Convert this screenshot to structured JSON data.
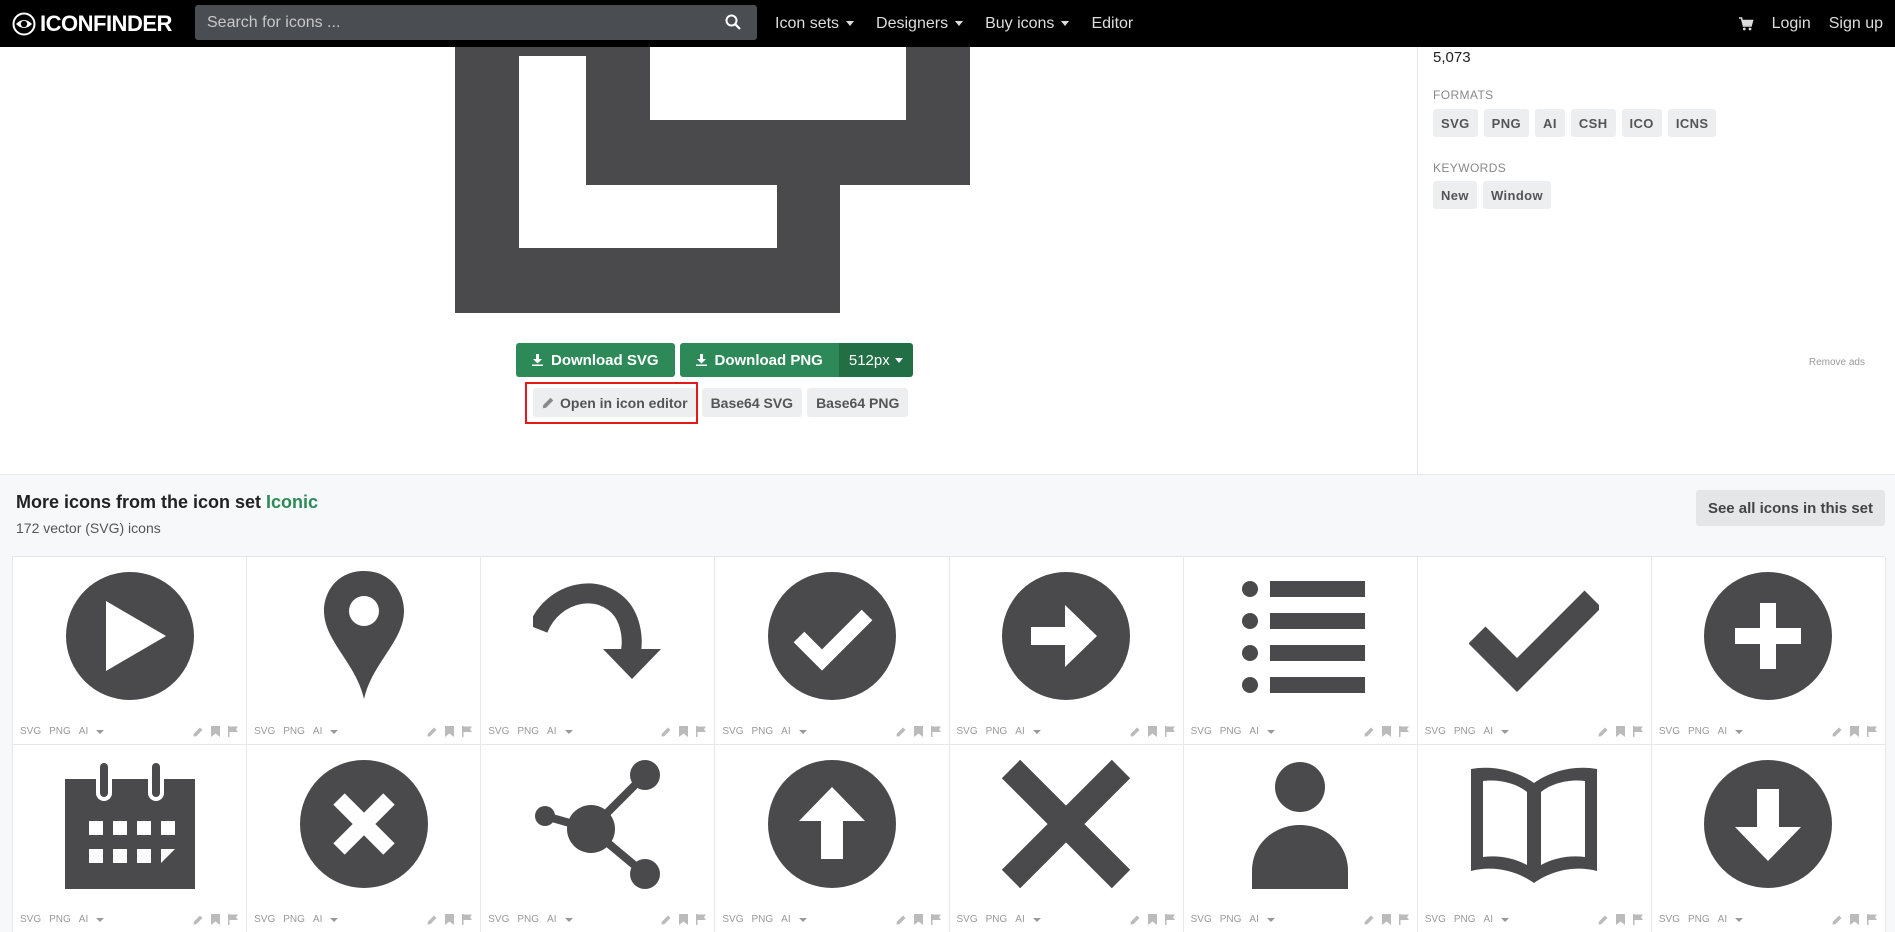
{
  "nav": {
    "brand": "ICONFINDER",
    "search_placeholder": "Search for icons ...",
    "links": [
      "Icon sets",
      "Designers",
      "Buy icons",
      "Editor"
    ],
    "login": "Login",
    "signup": "Sign up"
  },
  "actions": {
    "download_svg": "Download SVG",
    "download_png": "Download PNG",
    "size": "512px",
    "open_editor": "Open in icon editor",
    "base64_svg": "Base64 SVG",
    "base64_png": "Base64 PNG"
  },
  "sidebar": {
    "count": "5,073",
    "formats_label": "FORMATS",
    "formats": [
      "SVG",
      "PNG",
      "AI",
      "CSH",
      "ICO",
      "ICNS"
    ],
    "keywords_label": "KEYWORDS",
    "keywords": [
      "New",
      "Window"
    ],
    "remove_ads": "Remove ads"
  },
  "more": {
    "title_prefix": "More icons from the icon set ",
    "set_name": "Iconic",
    "subtitle": "172 vector (SVG) icons",
    "see_all": "See all icons in this set",
    "cell_formats": [
      "SVG",
      "PNG",
      "AI"
    ],
    "icons": [
      "play-circle-icon",
      "map-pin-icon",
      "redo-arrow-icon",
      "check-circle-icon",
      "arrow-right-circle-icon",
      "list-icon",
      "check-icon",
      "plus-circle-icon",
      "calendar-icon",
      "x-circle-icon",
      "share-icon",
      "arrow-up-circle-icon",
      "x-icon",
      "user-icon",
      "book-open-icon",
      "arrow-down-circle-icon"
    ]
  },
  "colors": {
    "accent_green": "#2d8a58",
    "icon_fill": "#4a4a4c",
    "highlight_red": "#e21a1a"
  }
}
